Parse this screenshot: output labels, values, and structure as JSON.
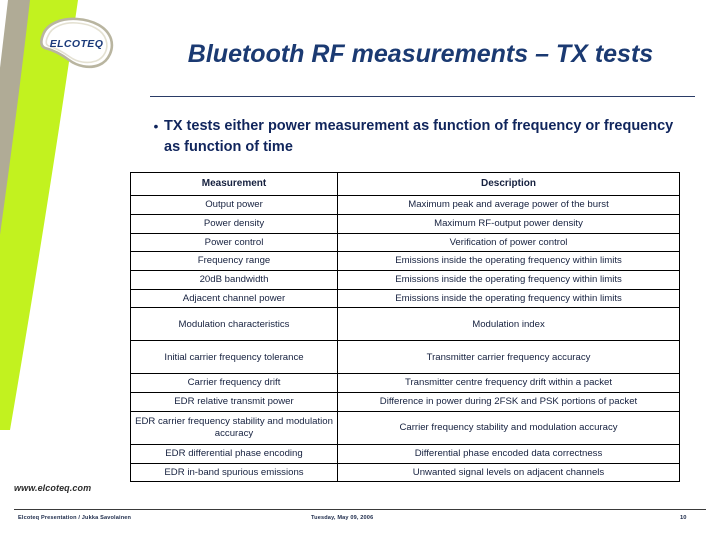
{
  "brand": {
    "logo_text": "ELCOTEQ",
    "website": "www.elcoteq.com",
    "accent_green": "#c2f21f",
    "accent_taupe": "#b0ab96",
    "title_navy": "#1b3a72"
  },
  "title": "Bluetooth RF measurements – TX tests",
  "bullet": {
    "marker": "•",
    "text": "TX tests either power measurement as function of frequency or frequency as function of time"
  },
  "table": {
    "headers": [
      "Measurement",
      "Description"
    ],
    "rows": [
      [
        "Output power",
        "Maximum peak and average power of the burst"
      ],
      [
        "Power density",
        "Maximum RF-output power density"
      ],
      [
        "Power control",
        "Verification of power control"
      ],
      [
        "Frequency range",
        "Emissions inside the operating frequency within limits"
      ],
      [
        "20dB bandwidth",
        "Emissions inside the operating frequency within limits"
      ],
      [
        "Adjacent channel power",
        "Emissions inside the operating frequency within limits"
      ],
      [
        "Modulation characteristics",
        "Modulation index"
      ],
      [
        "Initial carrier frequency tolerance",
        "Transmitter carrier frequency accuracy"
      ],
      [
        "Carrier frequency drift",
        "Transmitter centre frequency drift within a packet"
      ],
      [
        "EDR relative transmit power",
        "Difference in power during 2FSK and PSK portions of packet"
      ],
      [
        "EDR carrier frequency stability and modulation accuracy",
        "Carrier frequency stability and modulation accuracy"
      ],
      [
        "EDR differential phase encoding",
        "Differential phase encoded data correctness"
      ],
      [
        "EDR in-band spurious emissions",
        "Unwanted signal levels on adjacent channels"
      ]
    ]
  },
  "footer": {
    "left": "Elcoteq Presentation / Jukka Savolainen",
    "center": "Tuesday, May 09, 2006",
    "page": "10"
  }
}
